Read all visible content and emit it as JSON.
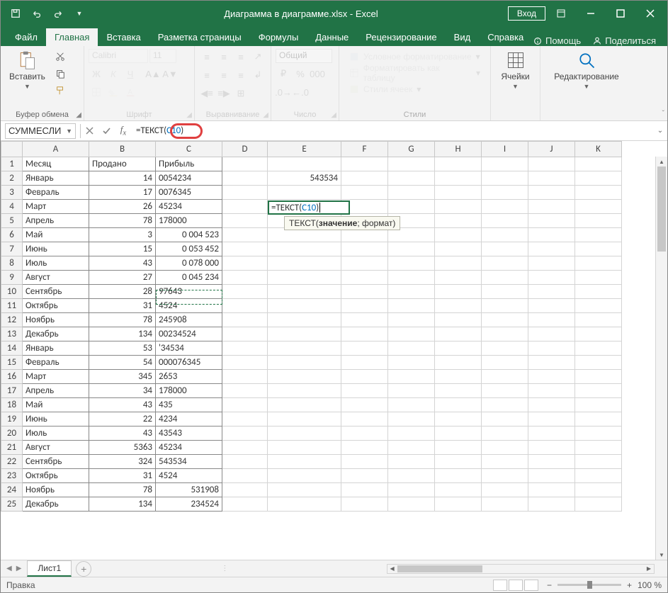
{
  "title": "Диаграмма в диаграмме.xlsx - Excel",
  "login": "Вход",
  "tabs": {
    "file": "Файл",
    "home": "Главная",
    "insert": "Вставка",
    "layout": "Разметка страницы",
    "formulas": "Формулы",
    "data": "Данные",
    "review": "Рецензирование",
    "view": "Вид",
    "help": "Справка",
    "tellme": "Помощь",
    "share": "Поделиться"
  },
  "ribbon": {
    "paste": "Вставить",
    "clipboard": "Буфер обмена",
    "font_name": "Calibri",
    "font_size": "11",
    "font": "Шрифт",
    "alignment": "Выравнивание",
    "number_format": "Общий",
    "number": "Число",
    "cond_format": "Условное форматирование",
    "format_table": "Форматировать как таблицу",
    "cell_styles": "Стили ячеек",
    "styles": "Стили",
    "cells": "Ячейки",
    "editing": "Редактирование"
  },
  "formula_bar": {
    "name_box": "СУММЕСЛИ",
    "formula_prefix": "=ТЕКСТ(",
    "formula_ref": "C10",
    "formula_suffix": ")"
  },
  "columns": [
    "A",
    "B",
    "C",
    "D",
    "E",
    "F",
    "G",
    "H",
    "I",
    "J",
    "K"
  ],
  "headers": {
    "A": "Месяц",
    "B": "Продано",
    "C": "Прибыль"
  },
  "rows": [
    {
      "n": 1,
      "A": "Месяц",
      "B": "Продано",
      "C": "Прибыль",
      "E": ""
    },
    {
      "n": 2,
      "A": "Январь",
      "B": "14",
      "C": "0054234",
      "E": "543534"
    },
    {
      "n": 3,
      "A": "Февраль",
      "B": "17",
      "C": "0076345"
    },
    {
      "n": 4,
      "A": "Март",
      "B": "26",
      "C": "45234"
    },
    {
      "n": 5,
      "A": "Апрель",
      "B": "78",
      "C": "178000"
    },
    {
      "n": 6,
      "A": "Май",
      "B": "3",
      "C": "0 004 523",
      "rt": true
    },
    {
      "n": 7,
      "A": "Июнь",
      "B": "15",
      "C": "0 053 452",
      "rt": true
    },
    {
      "n": 8,
      "A": "Июль",
      "B": "43",
      "C": "0 078 000",
      "rt": true
    },
    {
      "n": 9,
      "A": "Август",
      "B": "27",
      "C": "0 045 234",
      "rt": true
    },
    {
      "n": 10,
      "A": "Сентябрь",
      "B": "28",
      "C": "97643"
    },
    {
      "n": 11,
      "A": "Октябрь",
      "B": "31",
      "C": "4524"
    },
    {
      "n": 12,
      "A": "Ноябрь",
      "B": "78",
      "C": "245908"
    },
    {
      "n": 13,
      "A": "Декабрь",
      "B": "134",
      "C": "00234524"
    },
    {
      "n": 14,
      "A": "Январь",
      "B": "53",
      "C": "'34534"
    },
    {
      "n": 15,
      "A": "Февраль",
      "B": "54",
      "C": "000076345"
    },
    {
      "n": 16,
      "A": "Март",
      "B": "345",
      "C": "2653"
    },
    {
      "n": 17,
      "A": "Апрель",
      "B": "34",
      "C": "178000"
    },
    {
      "n": 18,
      "A": "Май",
      "B": "43",
      "C": "435"
    },
    {
      "n": 19,
      "A": "Июнь",
      "B": "22",
      "C": "4234"
    },
    {
      "n": 20,
      "A": "Июль",
      "B": "43",
      "C": "43543"
    },
    {
      "n": 21,
      "A": "Август",
      "B": "5363",
      "C": "45234"
    },
    {
      "n": 22,
      "A": "Сентябрь",
      "B": "324",
      "C": "543534"
    },
    {
      "n": 23,
      "A": "Октябрь",
      "B": "31",
      "C": "4524"
    },
    {
      "n": 24,
      "A": "Ноябрь",
      "B": "78",
      "C": "531908",
      "rt": true
    },
    {
      "n": 25,
      "A": "Декабрь",
      "B": "134",
      "C": "234524",
      "rt": true
    }
  ],
  "active_cell": {
    "label_prefix": "=ТЕКСТ(",
    "label_ref": "C10",
    "label_suffix": ")",
    "tooltip_func": "ТЕКСТ(",
    "tooltip_arg1": "значение",
    "tooltip_rest": "; формат)"
  },
  "sheet_tab": "Лист1",
  "status": {
    "mode": "Правка",
    "zoom": "100 %"
  }
}
